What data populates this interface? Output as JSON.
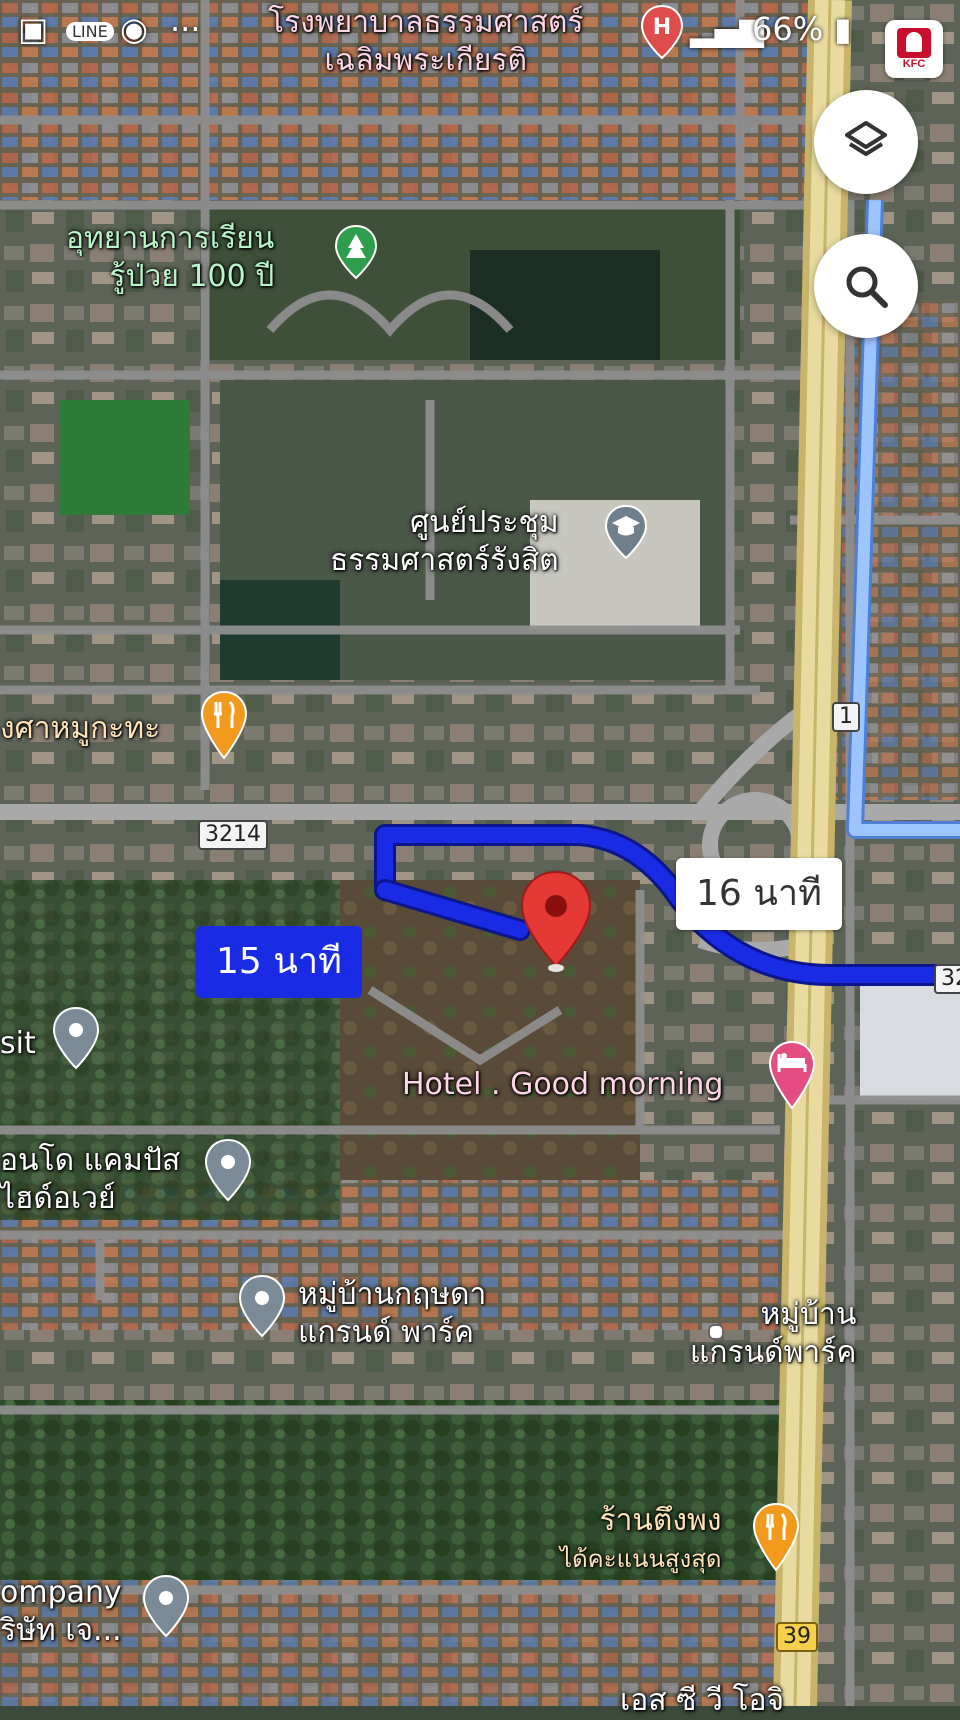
{
  "status_bar": {
    "battery": "66%",
    "icons": [
      "gallery-icon",
      "line-icon",
      "messenger-icon",
      "more-dots-icon",
      "signal-icon",
      "battery-icon"
    ]
  },
  "kfc_badge": "KFC",
  "buttons": {
    "layers": "layers-icon",
    "search": "search-icon"
  },
  "route": {
    "primary_duration": "15 นาที",
    "alternate_duration": "16 นาที",
    "primary_color": "#1a2be6",
    "alternate_color": "#9cc4ff"
  },
  "road_shields": {
    "r3214": "3214",
    "r1": "1",
    "r39": "39",
    "r32_partial": "32"
  },
  "places": {
    "hospital_line1": "โรงพยาบาลธรรมศาสตร์",
    "hospital_line2": "เฉลิมพระเกียรติ",
    "park_line1": "อุทยานการเรียน",
    "park_line2": "รู้ป่วย 100 ปี",
    "convention_line1": "ศูนย์ประชุม",
    "convention_line2": "ธรรมศาสตร์รังสิต",
    "restaurant_left": "งศาหมูกะทะ",
    "hotel": "Hotel . Good morning",
    "visit_partial": "sit",
    "condo_line1": "อนโด แคมปัส",
    "condo_line2": "ไฮด์อเวย์",
    "village1_line1": "หมู่บ้านกฤษดา",
    "village1_line2": "แกรนด์ พาร์ค",
    "village2_line1": "หมู่บ้าน",
    "village2_line2": "แกรนด์พาร์ค",
    "restaurant_right_line1": "ร้านตึงพง",
    "restaurant_right_line2": "ได้คะแนนสูงสุด",
    "company_line1": "ompany",
    "company_line2": "ริษัท เจ...",
    "bottom_partial": "เอส ซี วี โอจิ"
  }
}
